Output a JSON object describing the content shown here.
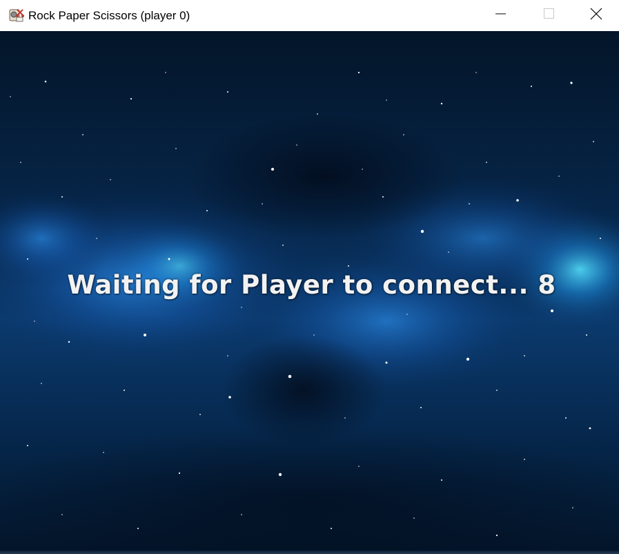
{
  "window": {
    "title": "Rock Paper Scissors (player 0)",
    "app_icon": "rock-paper-scissors-app-icon",
    "controls": {
      "minimize_icon": "minimize-icon",
      "maximize_icon": "maximize-icon",
      "close_icon": "close-icon"
    }
  },
  "game": {
    "background": "starfield-nebula",
    "status_message": "Waiting for Player to connect... 8",
    "colors": {
      "space_dark": "#031226",
      "nebula_blue": "#1a6fd0",
      "nebula_cyan": "#2fd8ff",
      "text": "#f2f2f2"
    }
  }
}
